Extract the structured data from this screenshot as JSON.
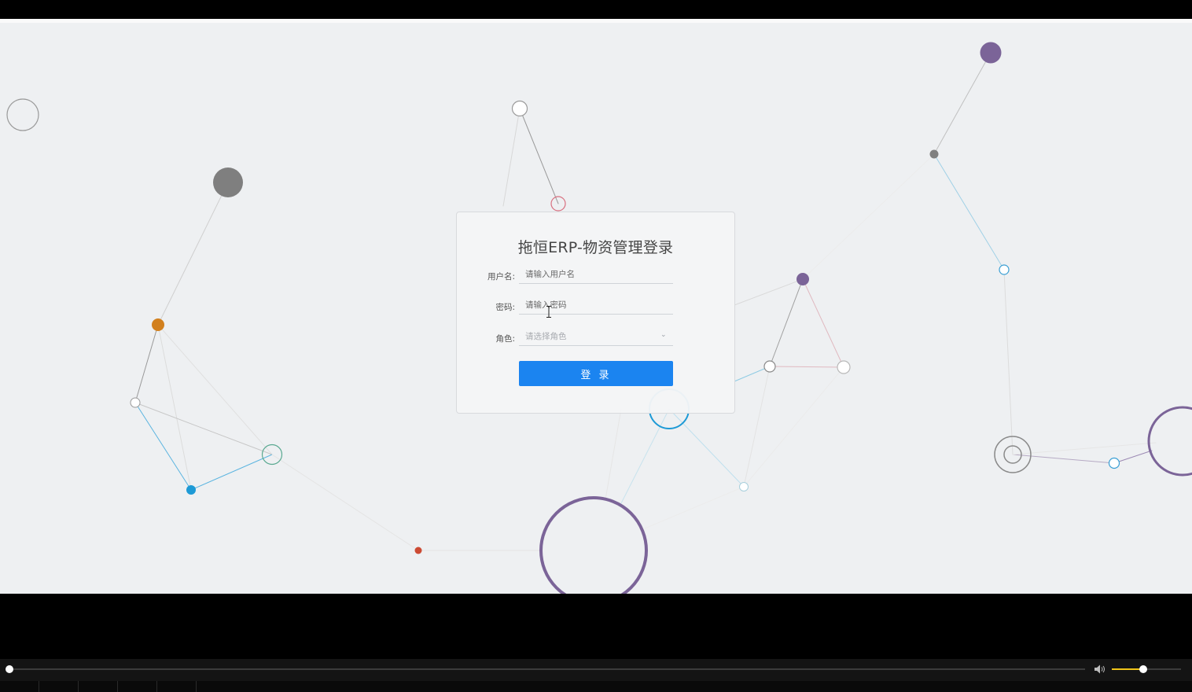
{
  "login": {
    "title": "拖恒ERP-物资管理登录",
    "username_label": "用户名:",
    "username_placeholder": "请输入用户名",
    "password_label": "密码:",
    "password_placeholder": "请输入密码",
    "role_label": "角色:",
    "role_placeholder": "请选择角色",
    "login_button": "登 录"
  },
  "player": {
    "progress": 0.0,
    "volume": 0.45
  },
  "colors": {
    "background": "#eef0f2",
    "primary_button": "#1b84f0",
    "volume_accent": "#f0c419",
    "node_purple": "#7b6498",
    "node_orange": "#d2801e",
    "node_blue": "#1d9ad6",
    "node_red": "#cc4a33",
    "node_gray": "#808080"
  }
}
